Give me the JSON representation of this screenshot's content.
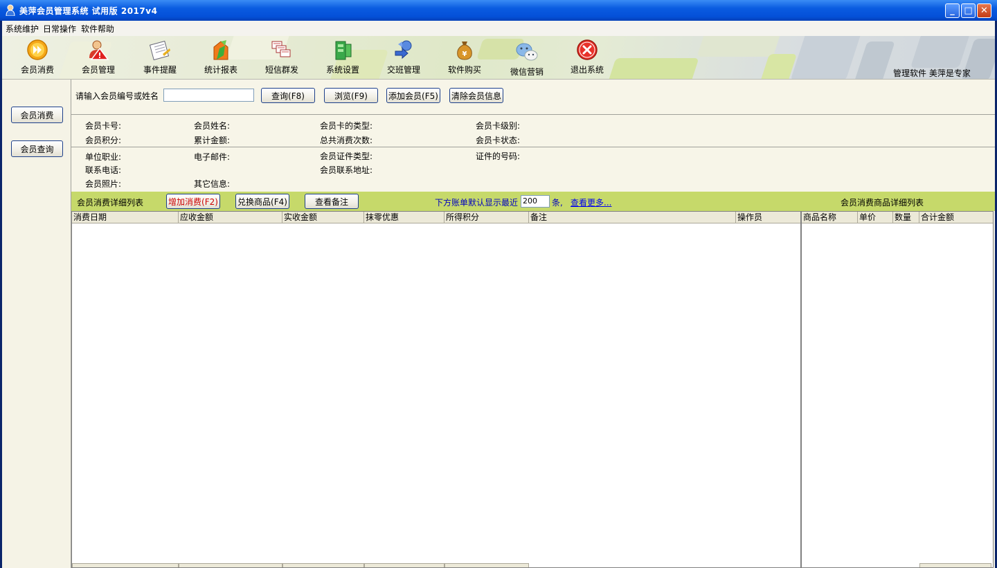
{
  "window": {
    "title": "美萍会员管理系统 试用版  2017v4"
  },
  "menu": [
    "系统维护",
    "日常操作",
    "软件帮助"
  ],
  "toolbar": {
    "items": [
      {
        "label": "会员消费",
        "icon": "consume-icon"
      },
      {
        "label": "会员管理",
        "icon": "member-manage-icon"
      },
      {
        "label": "事件提醒",
        "icon": "reminder-icon"
      },
      {
        "label": "统计报表",
        "icon": "report-icon"
      },
      {
        "label": "短信群发",
        "icon": "sms-icon"
      },
      {
        "label": "系统设置",
        "icon": "settings-icon"
      },
      {
        "label": "交班管理",
        "icon": "shift-icon"
      },
      {
        "label": "软件购买",
        "icon": "purchase-icon"
      },
      {
        "label": "微信营销",
        "icon": "wechat-icon"
      },
      {
        "label": "退出系统",
        "icon": "exit-icon"
      }
    ],
    "right_text": "管理软件  美萍是专家"
  },
  "sidebar": {
    "consume_button": "会员消费",
    "query_button": "会员查询"
  },
  "search": {
    "label": "请输入会员编号或姓名",
    "value": "",
    "query_button": "查询(F8)",
    "browse_button": "浏览(F9)",
    "add_button": "添加会员(F5)",
    "clear_button": "清除会员信息"
  },
  "info": {
    "card_no": "会员卡号:",
    "name": "会员姓名:",
    "card_type": "会员卡的类型:",
    "card_level": "会员卡级别:",
    "points": "会员积分:",
    "total_amount": "累计金额:",
    "total_count": "总共消费次数:",
    "card_status": "会员卡状态:",
    "job": "单位职业:",
    "email": "电子邮件:",
    "id_type": "会员证件类型:",
    "id_no": "证件的号码:",
    "phone": "联系电话:",
    "address": "会员联系地址:",
    "photo": "会员照片:",
    "other": "其它信息:"
  },
  "detail": {
    "title": "会员消费详细列表",
    "add_button": "增加消费(F2)",
    "exchange_button": "兑换商品(F4)",
    "remark_button": "查看备注",
    "recent_prefix": "下方账单默认显示最近",
    "recent_value": "200",
    "recent_suffix": "条,",
    "more_link": "查看更多...",
    "goods_title": "会员消费商品详细列表"
  },
  "main_table": {
    "columns": [
      "消费日期",
      "应收金额",
      "实收金额",
      "抹零优惠",
      "所得积分",
      "备注",
      "操作员"
    ]
  },
  "goods_table": {
    "columns": [
      "商品名称",
      "单价",
      "数量",
      "合计金额"
    ]
  },
  "colors": {
    "titlebar": "#0450d8",
    "green_bar": "#c6d96a",
    "add_button_text": "#cc0000",
    "link": "#0000ee"
  }
}
